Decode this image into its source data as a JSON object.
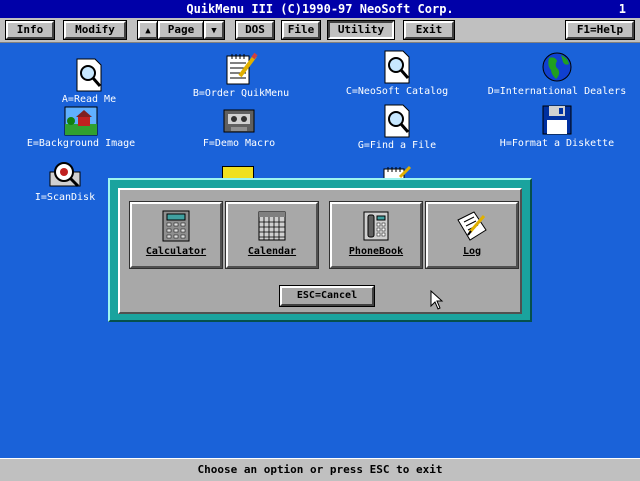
{
  "window": {
    "title": "QuikMenu III (C)1990-97 NeoSoft Corp.",
    "number": "1"
  },
  "menubar": {
    "info": "Info",
    "modify": "Modify",
    "page": "Page",
    "dos": "DOS",
    "file": "File",
    "utility": "Utility",
    "exit": "Exit",
    "help": "F1=Help"
  },
  "desktop": {
    "items": [
      {
        "label": "A=Read Me",
        "icon": "magnifier-document-icon"
      },
      {
        "label": "B=Order QuikMenu",
        "icon": "notepad-pencil-icon"
      },
      {
        "label": "C=NeoSoft Catalog",
        "icon": "magnifier-document-icon"
      },
      {
        "label": "D=International Dealers",
        "icon": "globe-icon"
      },
      {
        "label": "E=Background Image",
        "icon": "landscape-picture-icon"
      },
      {
        "label": "F=Demo Macro",
        "icon": "cassette-tape-icon"
      },
      {
        "label": "G=Find a File",
        "icon": "magnifier-document-icon"
      },
      {
        "label": "H=Format a Diskette",
        "icon": "floppy-disk-icon"
      },
      {
        "label": "I=ScanDisk",
        "icon": "disk-magnifier-icon"
      }
    ]
  },
  "dialog": {
    "buttons": [
      {
        "label": "Calculator",
        "icon": "calculator-icon"
      },
      {
        "label": "Calendar",
        "icon": "calendar-icon"
      },
      {
        "label": "PhoneBook",
        "icon": "telephone-icon"
      },
      {
        "label": "Log",
        "icon": "notepad-pencil-icon"
      }
    ],
    "cancel": "ESC=Cancel"
  },
  "status": "Choose an option or press ESC to exit"
}
